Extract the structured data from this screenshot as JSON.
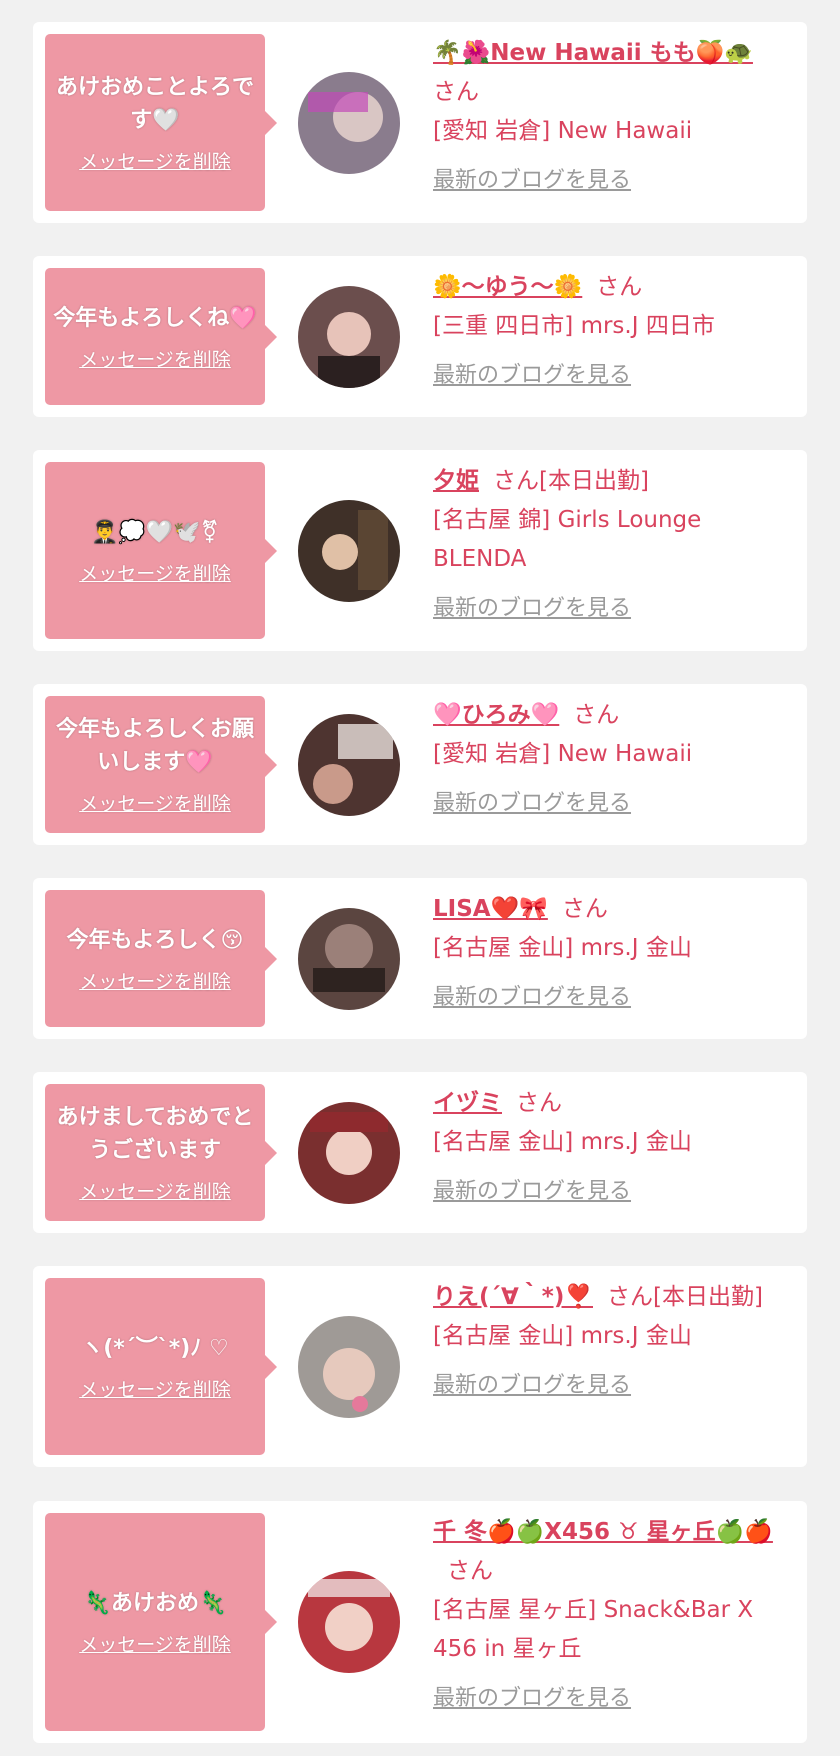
{
  "delete_label": "メッセージを削除",
  "blog_label": "最新のブログを見る",
  "cards": [
    {
      "message": "あけおめことよろです🤍",
      "name": "🌴🌺New Hawaii もも🍑🐢",
      "suffix": "さん",
      "shop": "[愛知 岩倉] New Hawaii",
      "avatar_color": "#8a7c8d"
    },
    {
      "message": "今年もよろしくね🩷",
      "name": "🌼〜ゆう〜🌼",
      "suffix": "さん",
      "shop": "[三重 四日市] mrs.J 四日市",
      "avatar_color": "#6b4e4d"
    },
    {
      "message": "👨‍✈️💭🤍🕊️⚧",
      "name": "夕姫",
      "suffix": "さん[本日出勤]",
      "shop": "[名古屋 錦] Girls Lounge BLENDA",
      "avatar_color": "#3f3028"
    },
    {
      "message": "今年もよろしくお願いします🩷",
      "name": "🩷ひろみ🩷",
      "suffix": "さん",
      "shop": "[愛知 岩倉] New Hawaii",
      "avatar_color": "#4e3430"
    },
    {
      "message": "今年もよろしく😚",
      "name": "LISA❤️🎀",
      "suffix": "さん",
      "shop": "[名古屋 金山] mrs.J 金山",
      "avatar_color": "#5b4540"
    },
    {
      "message": "あけましておめでとうございます",
      "name": "イヅミ",
      "suffix": "さん",
      "shop": "[名古屋 金山] mrs.J 金山",
      "avatar_color": "#7a2f2f"
    },
    {
      "message": "ヽ(*´︶`*)ﾉ ♡",
      "name": "りえ(´∀｀*)❣️",
      "suffix": "さん[本日出勤]",
      "shop": "[名古屋 金山] mrs.J 金山",
      "avatar_color": "#9f9a96"
    },
    {
      "message": "🦎あけおめ🦎",
      "name": "千 冬🍎🍏X456 ♉ 星ヶ丘🍏🍎",
      "suffix": "さん",
      "shop": "[名古屋 星ヶ丘] Snack&Bar X 456 in 星ヶ丘",
      "avatar_color": "#b8373f"
    }
  ]
}
